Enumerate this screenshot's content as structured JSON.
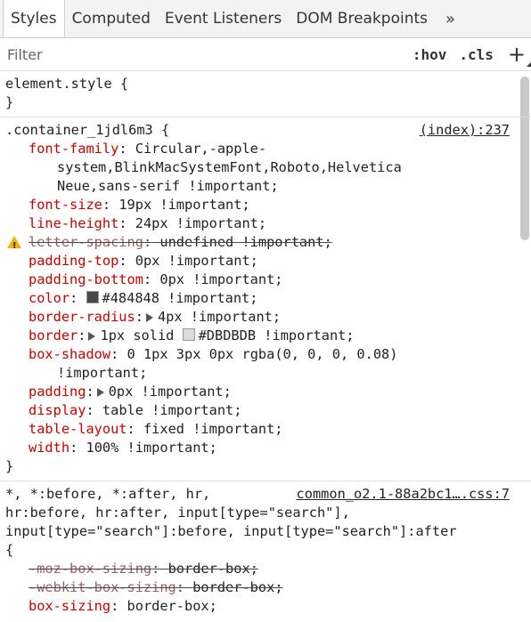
{
  "tabs": [
    {
      "label": "Styles",
      "active": true
    },
    {
      "label": "Computed",
      "active": false
    },
    {
      "label": "Event Listeners",
      "active": false
    },
    {
      "label": "DOM Breakpoints",
      "active": false
    }
  ],
  "tabs_more": "»",
  "filter": {
    "placeholder": "Filter",
    "hov": ":hov",
    "cls": ".cls",
    "add": "+"
  },
  "element_style": {
    "selector": "element.style {",
    "close": "}"
  },
  "rule1": {
    "selector": ".container_1jdl6m3 {",
    "source": "(index):237",
    "close": "}",
    "decls": [
      {
        "prop": "font-family",
        "value": "Circular,-apple-",
        "cont": [
          "system,BlinkMacSystemFont,Roboto,Helvetica",
          "Neue,sans-serif !important;"
        ]
      },
      {
        "prop": "font-size",
        "value": "19px !important;"
      },
      {
        "prop": "line-height",
        "value": "24px !important;"
      },
      {
        "prop": "letter-spacing",
        "value": "undefined !important;",
        "struck": true,
        "warning": true
      },
      {
        "prop": "padding-top",
        "value": "0px !important;"
      },
      {
        "prop": "padding-bottom",
        "value": "0px !important;"
      },
      {
        "prop": "color",
        "value": "#484848 !important;",
        "swatch": "#484848"
      },
      {
        "prop": "border-radius",
        "value": "4px !important;",
        "expandable": true
      },
      {
        "prop": "border",
        "value": "1px solid ",
        "swatch": "#DBDBDB",
        "value2": "#DBDBDB !important;",
        "expandable": true
      },
      {
        "prop": "box-shadow",
        "value": "0 1px 3px 0px rgba(0, 0, 0, 0.08)",
        "cont": [
          "!important;"
        ]
      },
      {
        "prop": "padding",
        "value": "0px !important;",
        "expandable": true
      },
      {
        "prop": "display",
        "value": "table !important;"
      },
      {
        "prop": "table-layout",
        "value": "fixed !important;"
      },
      {
        "prop": "width",
        "value": "100% !important;"
      }
    ]
  },
  "rule2": {
    "selector_lines": [
      "*, *:before, *:after, hr,",
      "hr:before, hr:after, input[type=\"search\"],",
      "input[type=\"search\"]:before, input[type=\"search\"]:after"
    ],
    "source": "common_o2.1-88a2bc1….css:7",
    "open": "{",
    "decls": [
      {
        "prop": "-moz-box-sizing",
        "value": "border-box;",
        "struck": true
      },
      {
        "prop": "-webkit-box-sizing",
        "value": "border-box;",
        "struck": true
      },
      {
        "prop": "box-sizing",
        "value": "border-box;"
      }
    ]
  },
  "colors": {
    "property": "#c80000",
    "warning": "#f0b400"
  }
}
